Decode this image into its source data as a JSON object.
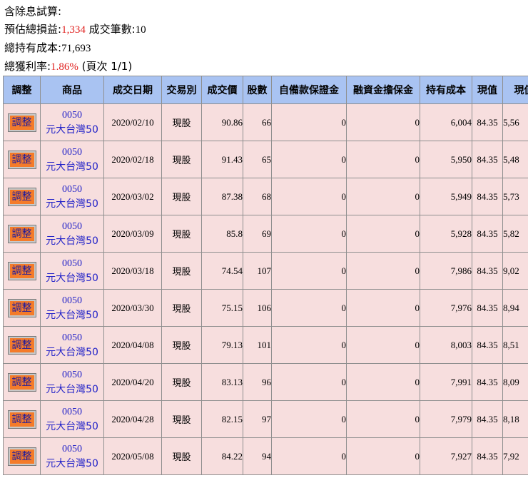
{
  "summary": {
    "title": "含除息試算:",
    "est_pl_label": "預估總損益:",
    "est_pl_value": "1,334",
    "deals_label": "成交筆數:",
    "deals_value": "10",
    "cost_label": "總持有成本:",
    "cost_value": "71,693",
    "rate_label": "總獲利率:",
    "rate_value": "1.86%",
    "page_text": "(頁次 1/1)"
  },
  "colors": {
    "header_bg": "#a9c3f2",
    "row_bg": "#f7dede",
    "accent_red": "#e0201e",
    "button_bg": "#f47b2a",
    "link_blue": "#2323c8"
  },
  "headers": [
    "調整",
    "商品",
    "成交日期",
    "交易別",
    "成交價",
    "股數",
    "自備款保證金",
    "融資金擔保金",
    "持有成本",
    "現值",
    "現值"
  ],
  "rows": [
    {
      "adjust": "調整",
      "code": "0050",
      "name": "元大台灣50",
      "date": "2020/02/10",
      "type": "現股",
      "price": "90.86",
      "shares": "66",
      "margin": "0",
      "finance": "0",
      "cost": "6,004",
      "now": "84.35",
      "value": "5,56"
    },
    {
      "adjust": "調整",
      "code": "0050",
      "name": "元大台灣50",
      "date": "2020/02/18",
      "type": "現股",
      "price": "91.43",
      "shares": "65",
      "margin": "0",
      "finance": "0",
      "cost": "5,950",
      "now": "84.35",
      "value": "5,48"
    },
    {
      "adjust": "調整",
      "code": "0050",
      "name": "元大台灣50",
      "date": "2020/03/02",
      "type": "現股",
      "price": "87.38",
      "shares": "68",
      "margin": "0",
      "finance": "0",
      "cost": "5,949",
      "now": "84.35",
      "value": "5,73"
    },
    {
      "adjust": "調整",
      "code": "0050",
      "name": "元大台灣50",
      "date": "2020/03/09",
      "type": "現股",
      "price": "85.8",
      "shares": "69",
      "margin": "0",
      "finance": "0",
      "cost": "5,928",
      "now": "84.35",
      "value": "5,82"
    },
    {
      "adjust": "調整",
      "code": "0050",
      "name": "元大台灣50",
      "date": "2020/03/18",
      "type": "現股",
      "price": "74.54",
      "shares": "107",
      "margin": "0",
      "finance": "0",
      "cost": "7,986",
      "now": "84.35",
      "value": "9,02"
    },
    {
      "adjust": "調整",
      "code": "0050",
      "name": "元大台灣50",
      "date": "2020/03/30",
      "type": "現股",
      "price": "75.15",
      "shares": "106",
      "margin": "0",
      "finance": "0",
      "cost": "7,976",
      "now": "84.35",
      "value": "8,94"
    },
    {
      "adjust": "調整",
      "code": "0050",
      "name": "元大台灣50",
      "date": "2020/04/08",
      "type": "現股",
      "price": "79.13",
      "shares": "101",
      "margin": "0",
      "finance": "0",
      "cost": "8,003",
      "now": "84.35",
      "value": "8,51"
    },
    {
      "adjust": "調整",
      "code": "0050",
      "name": "元大台灣50",
      "date": "2020/04/20",
      "type": "現股",
      "price": "83.13",
      "shares": "96",
      "margin": "0",
      "finance": "0",
      "cost": "7,991",
      "now": "84.35",
      "value": "8,09"
    },
    {
      "adjust": "調整",
      "code": "0050",
      "name": "元大台灣50",
      "date": "2020/04/28",
      "type": "現股",
      "price": "82.15",
      "shares": "97",
      "margin": "0",
      "finance": "0",
      "cost": "7,979",
      "now": "84.35",
      "value": "8,18"
    },
    {
      "adjust": "調整",
      "code": "0050",
      "name": "元大台灣50",
      "date": "2020/05/08",
      "type": "現股",
      "price": "84.22",
      "shares": "94",
      "margin": "0",
      "finance": "0",
      "cost": "7,927",
      "now": "84.35",
      "value": "7,92"
    }
  ]
}
